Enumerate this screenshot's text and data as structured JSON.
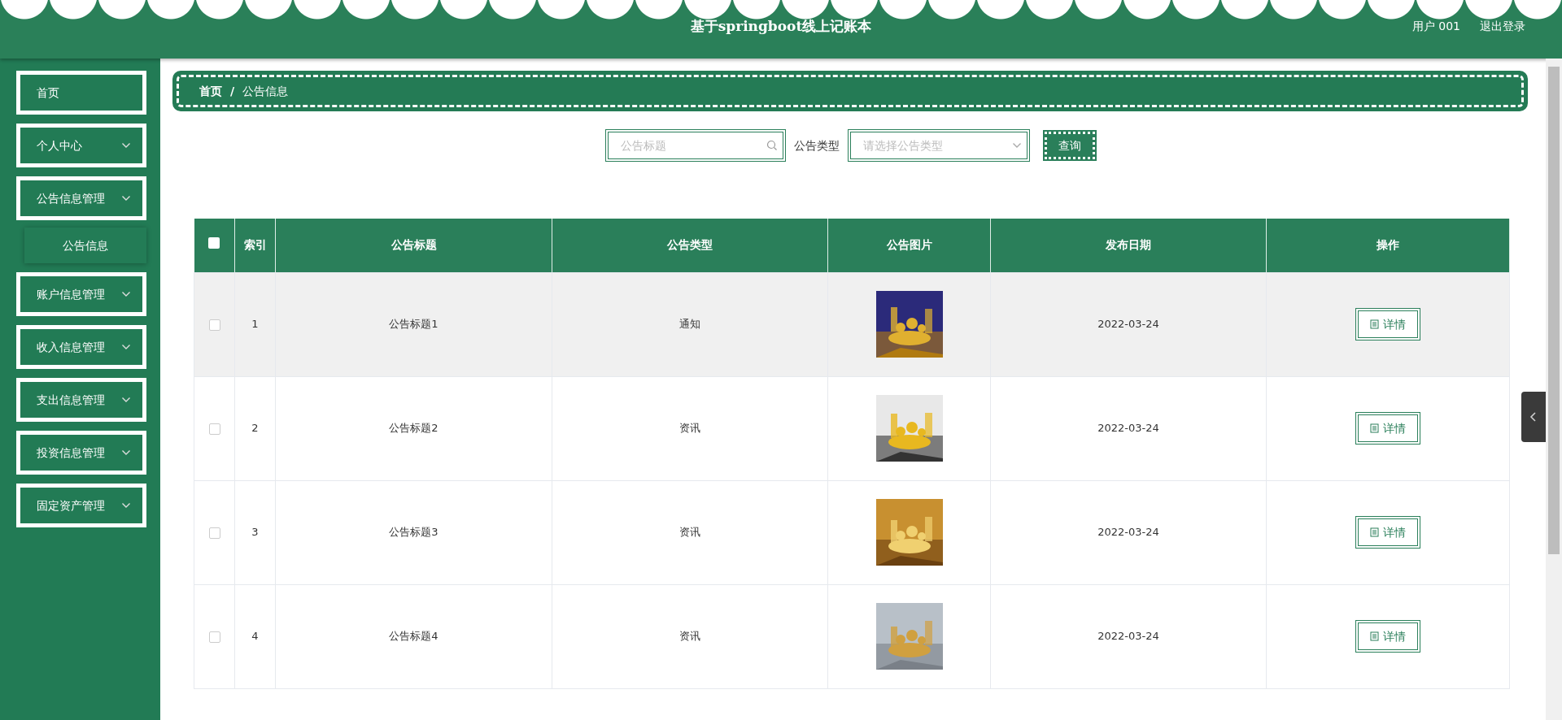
{
  "header": {
    "title": "基于springboot线上记账本",
    "user": "用户 001",
    "logout": "退出登录"
  },
  "sidebar": {
    "items": [
      {
        "label": "首页",
        "kind": "link"
      },
      {
        "label": "个人中心",
        "kind": "menu"
      },
      {
        "label": "公告信息管理",
        "kind": "menu",
        "children": [
          {
            "label": "公告信息",
            "selected": true
          }
        ]
      },
      {
        "label": "账户信息管理",
        "kind": "menu"
      },
      {
        "label": "收入信息管理",
        "kind": "menu"
      },
      {
        "label": "支出信息管理",
        "kind": "menu"
      },
      {
        "label": "投资信息管理",
        "kind": "menu"
      },
      {
        "label": "固定资产管理",
        "kind": "menu"
      }
    ]
  },
  "breadcrumb": {
    "items": [
      "首页",
      "公告信息"
    ],
    "separator": "/"
  },
  "search": {
    "title_placeholder": "公告标题",
    "type_label": "公告类型",
    "type_placeholder": "请选择公告类型",
    "button": "查询"
  },
  "table": {
    "columns": [
      "索引",
      "公告标题",
      "公告类型",
      "公告图片",
      "发布日期",
      "操作"
    ],
    "select_all_checked": false,
    "rows": [
      {
        "index": "1",
        "title": "公告标题1",
        "type": "通知",
        "date": "2022-03-24",
        "action": "详情",
        "checked": false,
        "hovered": true
      },
      {
        "index": "2",
        "title": "公告标题2",
        "type": "资讯",
        "date": "2022-03-24",
        "action": "详情",
        "checked": false,
        "hovered": false
      },
      {
        "index": "3",
        "title": "公告标题3",
        "type": "资讯",
        "date": "2022-03-24",
        "action": "详情",
        "checked": false,
        "hovered": false
      },
      {
        "index": "4",
        "title": "公告标题4",
        "type": "资讯",
        "date": "2022-03-24",
        "action": "详情",
        "checked": false,
        "hovered": false
      }
    ]
  }
}
